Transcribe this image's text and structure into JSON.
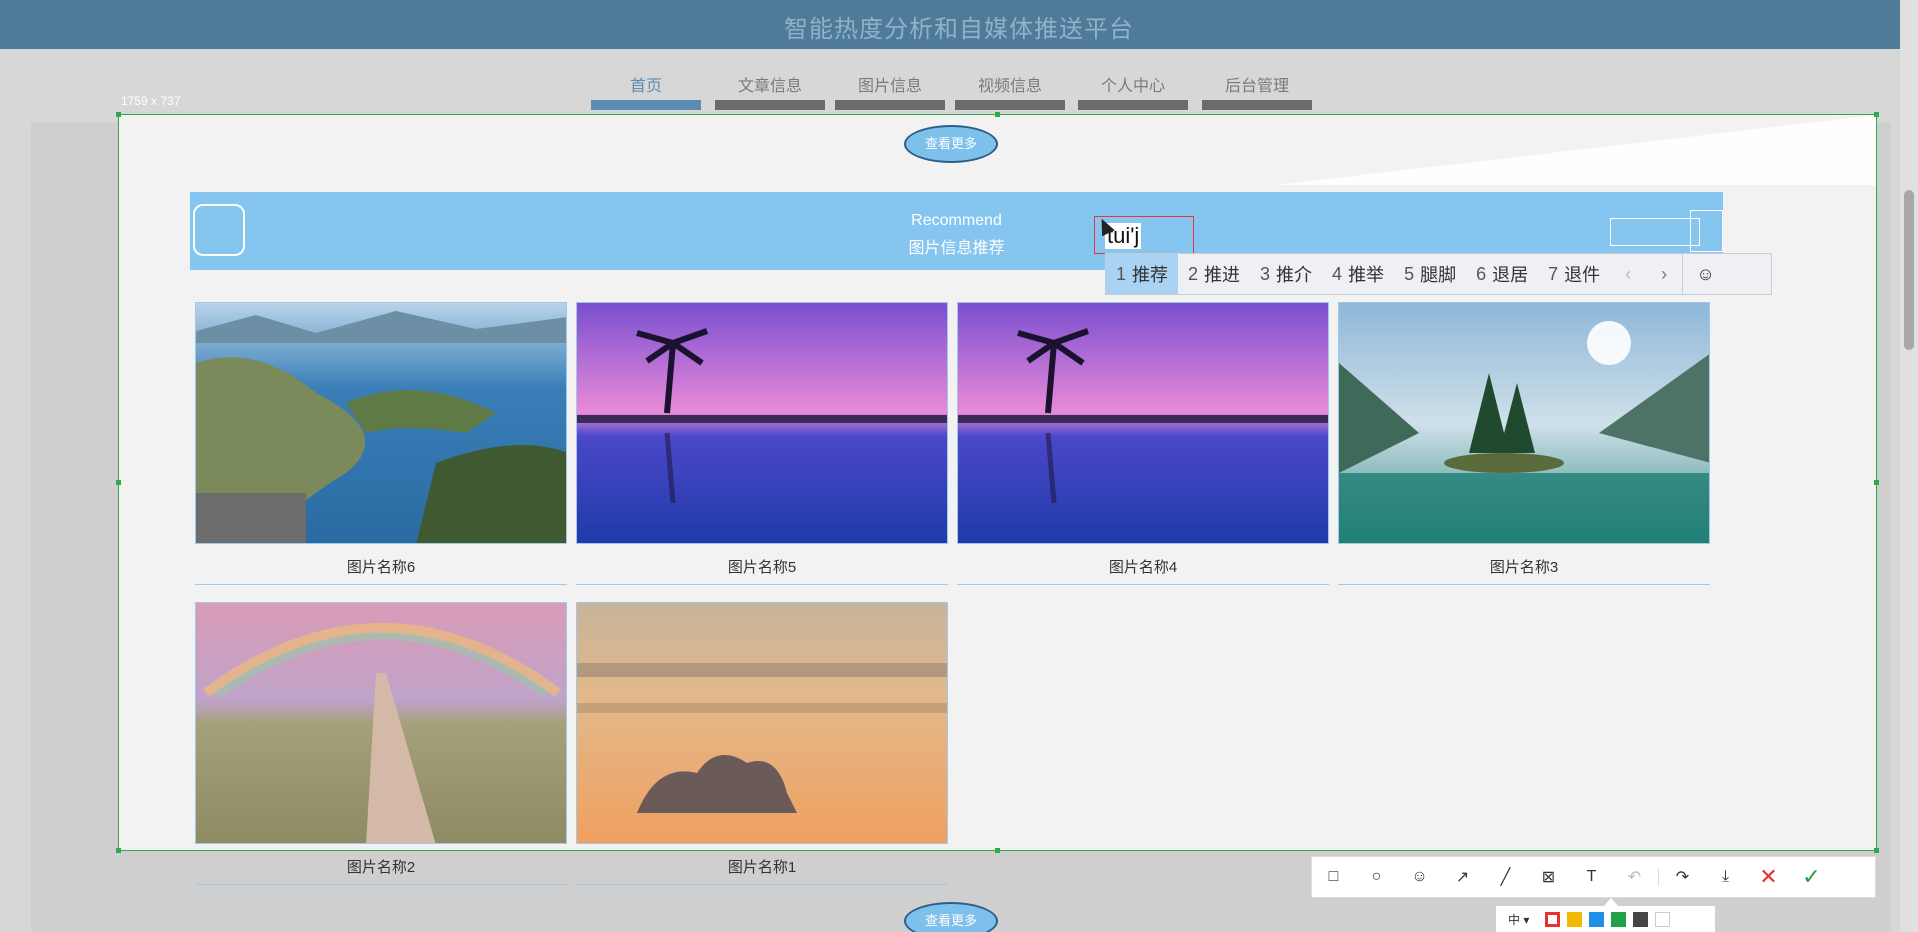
{
  "header": {
    "title": "智能热度分析和自媒体推送平台"
  },
  "nav": {
    "items": [
      {
        "label": "首页"
      },
      {
        "label": "文章信息"
      },
      {
        "label": "图片信息"
      },
      {
        "label": "视频信息"
      },
      {
        "label": "个人中心"
      },
      {
        "label": "后台管理"
      }
    ]
  },
  "capture": {
    "size_label": "1759 x 737"
  },
  "section": {
    "more_top": "查看更多",
    "more_bottom": "查看更多",
    "title_en": "Recommend",
    "title_cn": "图片信息推荐"
  },
  "text_tool": {
    "value": "tui'j"
  },
  "ime": {
    "candidates": [
      {
        "num": "1",
        "text": "推荐"
      },
      {
        "num": "2",
        "text": "推进"
      },
      {
        "num": "3",
        "text": "推介"
      },
      {
        "num": "4",
        "text": "推举"
      },
      {
        "num": "5",
        "text": "腿脚"
      },
      {
        "num": "6",
        "text": "退居"
      },
      {
        "num": "7",
        "text": "退件"
      }
    ],
    "prev": "‹",
    "next": "›",
    "emoji": "☺"
  },
  "cards": [
    {
      "name": "图片名称6"
    },
    {
      "name": "图片名称5"
    },
    {
      "name": "图片名称4"
    },
    {
      "name": "图片名称3"
    },
    {
      "name": "图片名称2"
    },
    {
      "name": "图片名称1"
    }
  ],
  "toolbar": {
    "tools": [
      {
        "glyph": "□"
      },
      {
        "glyph": "○"
      },
      {
        "glyph": "☺"
      },
      {
        "glyph": "↗"
      },
      {
        "glyph": "╱"
      },
      {
        "glyph": "⊠"
      },
      {
        "glyph": "T"
      },
      {
        "glyph": "↶"
      },
      {
        "glyph": "↷"
      },
      {
        "glyph": "⤓"
      },
      {
        "glyph": "✕"
      },
      {
        "glyph": "✓"
      }
    ]
  },
  "colorbar": {
    "size": "中 ▾",
    "colors": [
      "#e63232",
      "#f5b800",
      "#1e90e8",
      "#22a148",
      "#444444",
      "#ffffff"
    ]
  }
}
